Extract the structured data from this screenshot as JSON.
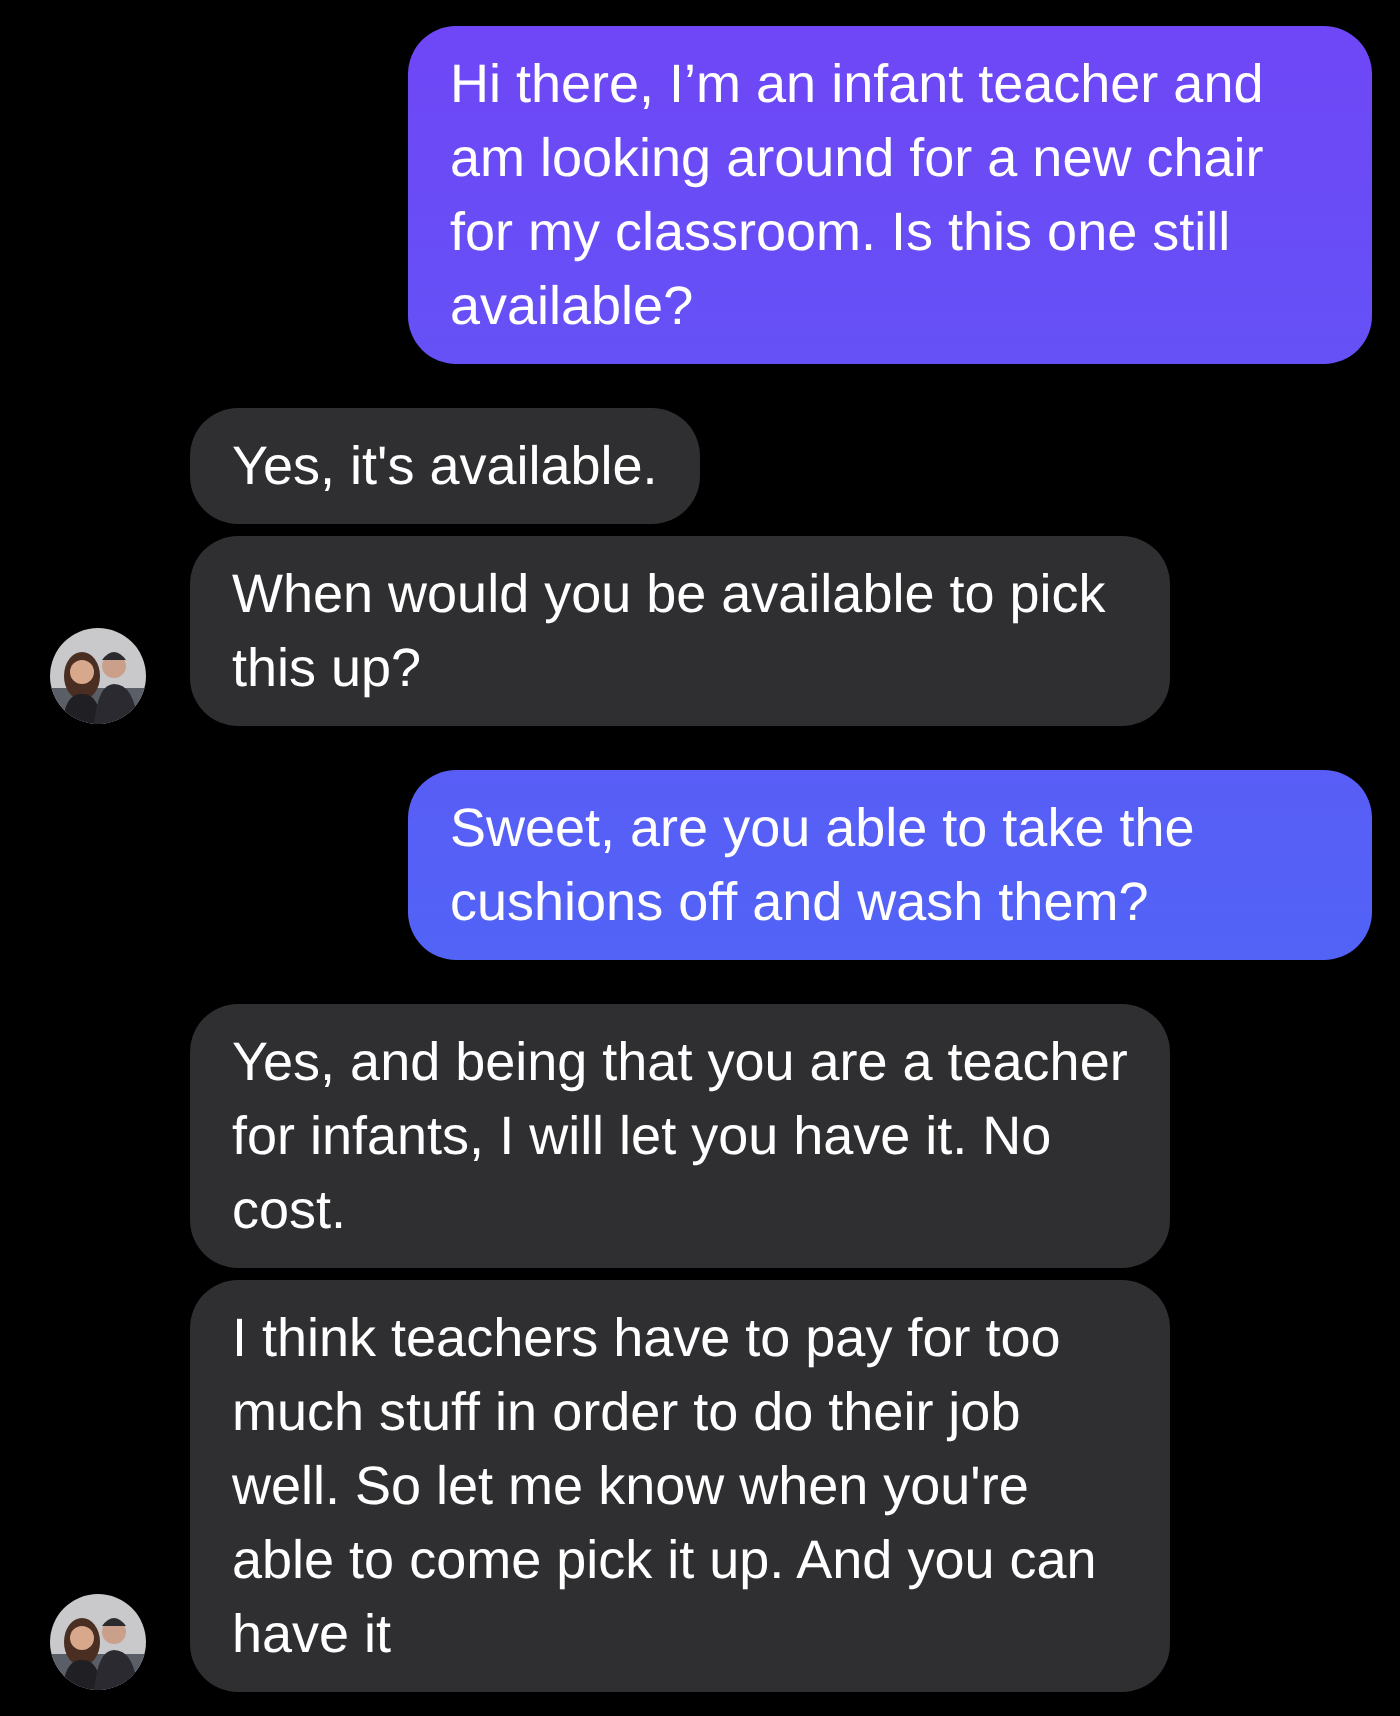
{
  "messages": [
    {
      "kind": "sent",
      "text": "Hi there, I’m an infant teacher and am looking around for a new chair for my classroom. Is this one still available?"
    },
    {
      "kind": "received",
      "text": "Yes, it's available.",
      "avatar": false
    },
    {
      "kind": "received",
      "text": "When would you be available to pick this up?",
      "avatar": true
    },
    {
      "kind": "sent",
      "text": "Sweet, are you able to take the cushions off and wash them?"
    },
    {
      "kind": "received",
      "text": "Yes, and being that you are a teacher for infants, I will let you have it. No cost.",
      "avatar": false
    },
    {
      "kind": "received",
      "text": "I think teachers have to pay for too much stuff in order to do their job well. So let me know when you're able to come pick it up. And you can have it",
      "avatar": true
    }
  ]
}
